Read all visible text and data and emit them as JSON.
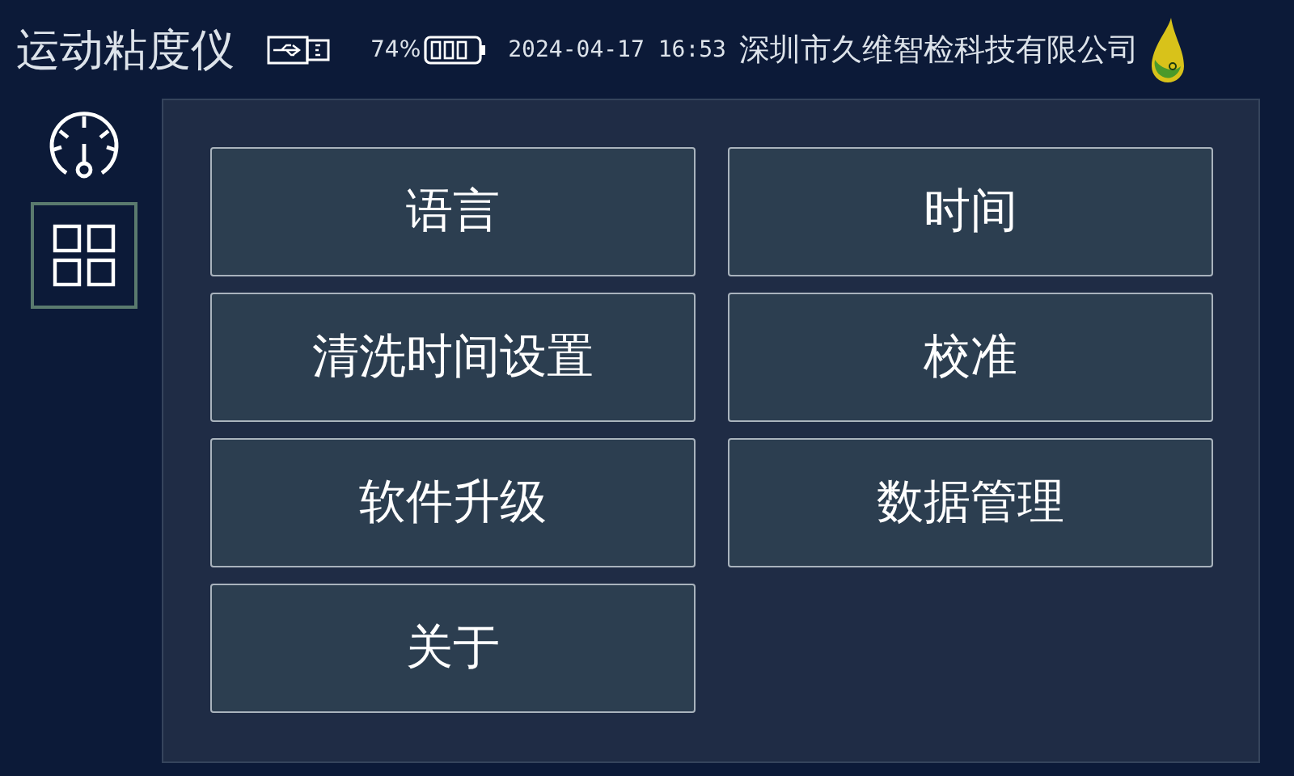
{
  "header": {
    "title": "运动粘度仪",
    "battery_percent": "74%",
    "datetime": "2024-04-17 16:53",
    "company": "深圳市久维智检科技有限公司"
  },
  "sidebar": {
    "items": [
      {
        "kind": "gauge",
        "selected": false
      },
      {
        "kind": "grid",
        "selected": true
      }
    ]
  },
  "menu_buttons": [
    {
      "label": "语言"
    },
    {
      "label": "时间"
    },
    {
      "label": "清洗时间设置"
    },
    {
      "label": "校准"
    },
    {
      "label": "软件升级"
    },
    {
      "label": "数据管理"
    },
    {
      "label": "关于"
    }
  ]
}
